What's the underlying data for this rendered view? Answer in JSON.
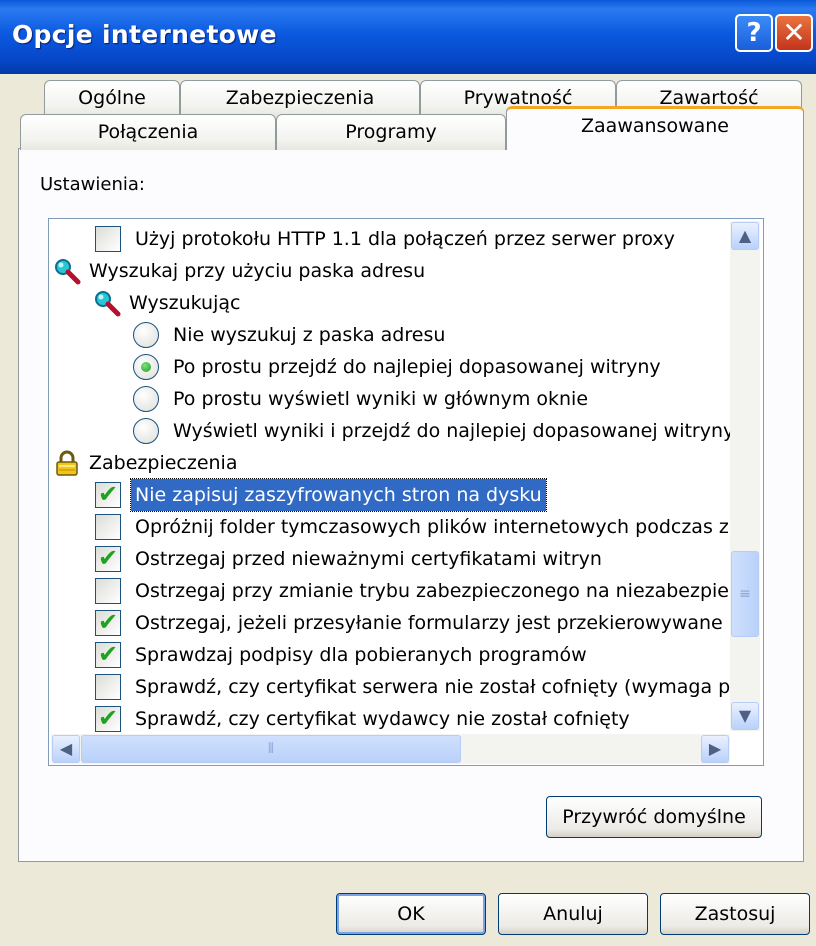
{
  "window": {
    "title": "Opcje internetowe",
    "help_label": "?",
    "close_label": "✕"
  },
  "tabs_row1": [
    "Ogólne",
    "Zabezpieczenia",
    "Prywatność",
    "Zawartość"
  ],
  "tabs_row2": [
    "Połączenia",
    "Programy",
    "Zaawansowane"
  ],
  "active_tab": "Zaawansowane",
  "settings_label": "Ustawienia:",
  "settings_items": [
    {
      "type": "checkbox",
      "checked": false,
      "label": "Użyj protokołu HTTP 1.1 dla połączeń przez serwer proxy"
    },
    {
      "type": "group",
      "icon": "magnifier-icon",
      "label": "Wyszukaj przy użyciu paska adresu"
    },
    {
      "type": "group",
      "icon": "magnifier-icon",
      "label": "Wyszukując"
    },
    {
      "type": "radio",
      "selected": false,
      "label": "Nie wyszukuj z paska adresu"
    },
    {
      "type": "radio",
      "selected": true,
      "label": "Po prostu przejdź do najlepiej dopasowanej witryny"
    },
    {
      "type": "radio",
      "selected": false,
      "label": "Po prostu wyświetl wyniki w głównym oknie"
    },
    {
      "type": "radio",
      "selected": false,
      "label": "Wyświetl wyniki i przejdź do najlepiej dopasowanej witryny"
    },
    {
      "type": "group",
      "icon": "padlock-icon",
      "label": "Zabezpieczenia"
    },
    {
      "type": "checkbox",
      "checked": true,
      "highlighted": true,
      "label": "Nie zapisuj zaszyfrowanych stron na dysku"
    },
    {
      "type": "checkbox",
      "checked": false,
      "label": "Opróżnij folder tymczasowych plików internetowych podczas z"
    },
    {
      "type": "checkbox",
      "checked": true,
      "label": "Ostrzegaj przed nieważnymi certyfikatami witryn"
    },
    {
      "type": "checkbox",
      "checked": false,
      "label": "Ostrzegaj przy zmianie trybu zabezpieczonego na niezabezpiec"
    },
    {
      "type": "checkbox",
      "checked": true,
      "label": "Ostrzegaj, jeżeli przesyłanie formularzy jest przekierowywane"
    },
    {
      "type": "checkbox",
      "checked": true,
      "label": "Sprawdzaj podpisy dla pobieranych programów"
    },
    {
      "type": "checkbox",
      "checked": false,
      "label": "Sprawdź, czy certyfikat serwera nie został cofnięty (wymaga p"
    },
    {
      "type": "checkbox",
      "checked": true,
      "label": "Sprawdź, czy certyfikat wydawcy nie został cofnięty"
    }
  ],
  "restore_defaults_label": "Przywróć domyślne",
  "buttons": {
    "ok": "OK",
    "cancel": "Anuluj",
    "apply": "Zastosuj"
  },
  "colors": {
    "title_bar": "#0a58d8",
    "selection": "#316ac5",
    "check": "#21a121",
    "active_tab_accent": "#f5a623"
  }
}
